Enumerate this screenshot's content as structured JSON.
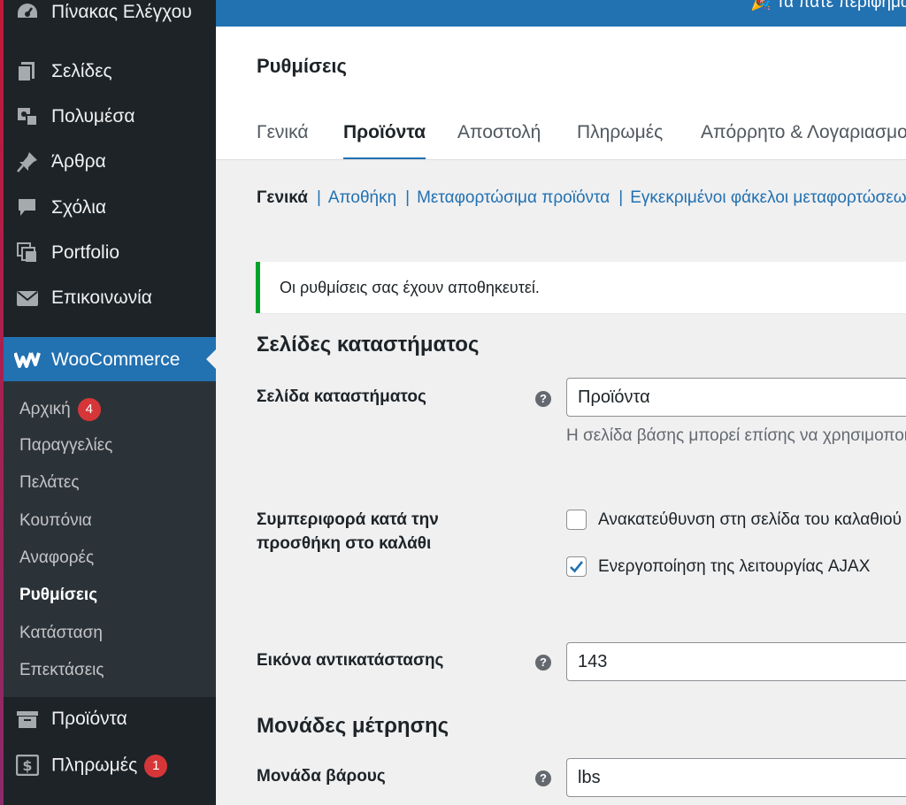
{
  "sidebar": {
    "dashboard": {
      "label": "Πίνακας Ελέγχου",
      "icon": "dashboard-icon"
    },
    "pages": {
      "label": "Σελίδες",
      "icon": "pages-icon"
    },
    "media": {
      "label": "Πολυμέσα",
      "icon": "media-icon"
    },
    "posts": {
      "label": "Άρθρα",
      "icon": "pin-icon"
    },
    "comments": {
      "label": "Σχόλια",
      "icon": "comment-icon"
    },
    "portfolio": {
      "label": "Portfolio",
      "icon": "portfolio-icon"
    },
    "contact": {
      "label": "Επικοινωνία",
      "icon": "envelope-icon"
    },
    "woocommerce": {
      "label": "WooCommerce",
      "icon": "woocommerce-icon"
    },
    "submenu": {
      "home": {
        "label": "Αρχική",
        "badge": "4"
      },
      "orders": {
        "label": "Παραγγελίες"
      },
      "customers": {
        "label": "Πελάτες"
      },
      "coupons": {
        "label": "Κουπόνια"
      },
      "reports": {
        "label": "Αναφορές"
      },
      "settings": {
        "label": "Ρυθμίσεις"
      },
      "status": {
        "label": "Κατάσταση"
      },
      "extensions": {
        "label": "Επεκτάσεις"
      }
    },
    "products": {
      "label": "Προϊόντα",
      "icon": "archive-icon"
    },
    "payments": {
      "label": "Πληρωμές",
      "icon": "dollar-icon",
      "badge": "1"
    }
  },
  "topbar": {
    "notice": "Τα πάτε περίφημα"
  },
  "header": {
    "title": "Ρυθμίσεις",
    "tabs": {
      "general": "Γενικά",
      "products": "Προϊόντα",
      "shipping": "Αποστολή",
      "payments": "Πληρωμές",
      "privacy": "Απόρρητο & Λογαριασμοί"
    }
  },
  "subnav": {
    "general": "Γενικά",
    "inventory": "Αποθήκη",
    "downloadable": "Μεταφορτώσιμα προϊόντα",
    "approved": "Εγκεκριμένοι φάκελοι μεταφορτώσεων",
    "separator": "|"
  },
  "notice": {
    "text": "Οι ρυθμίσεις σας έχουν αποθηκευτεί."
  },
  "shop_pages": {
    "title": "Σελίδες καταστήματος",
    "shop_page_label": "Σελίδα καταστήματος",
    "shop_page_value": "Προϊόντα",
    "shop_page_desc": "Η σελίδα βάσης μπορεί επίσης να χρησιμοποιηθεί",
    "cart_behaviour_label_1": "Συμπεριφορά κατά την",
    "cart_behaviour_label_2": "προσθήκη στο καλάθι",
    "redirect_label": "Ανακατεύθυνση στη σελίδα του καλαθιού",
    "redirect_checked": false,
    "ajax_label": "Ενεργοποίηση της λειτουργίας AJAX",
    "ajax_checked": true,
    "placeholder_label": "Εικόνα αντικατάστασης",
    "placeholder_value": "143"
  },
  "measurements": {
    "title": "Μονάδες μέτρησης",
    "weight_label": "Μονάδα βάρους",
    "weight_value": "lbs"
  },
  "help_glyph": "?",
  "colors": {
    "admin_bar": "#2271b1",
    "sidebar": "#1d2327",
    "submenu": "#2c3338",
    "success": "#00a32a",
    "badge": "#d63638",
    "link": "#2271b1"
  }
}
